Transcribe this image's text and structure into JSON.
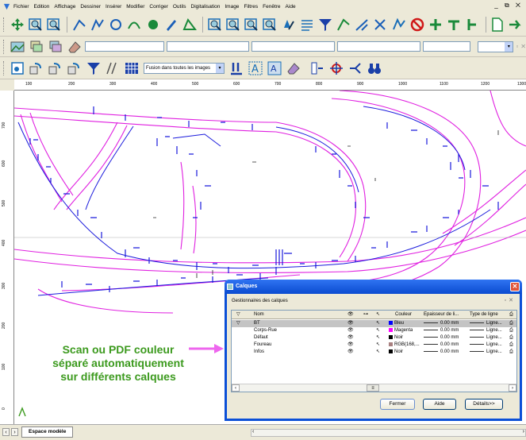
{
  "menubar": {
    "items": [
      "Fichier",
      "Edition",
      "Affichage",
      "Dessiner",
      "Insérer",
      "Modifier",
      "Corriger",
      "Outils",
      "Digitalisation",
      "Image",
      "Filtres",
      "Fenêtre",
      "Aide"
    ],
    "window_controls": "_ ⧉ ✕"
  },
  "toolbar3": {
    "fusion_select": "Fusion dans toutes les images"
  },
  "ruler": {
    "top_ticks": [
      "100",
      "200",
      "300",
      "400",
      "500",
      "600",
      "700",
      "800",
      "900",
      "1000",
      "1100",
      "1200",
      "1300"
    ],
    "left_ticks": [
      "700",
      "600",
      "500",
      "400",
      "300",
      "200",
      "100",
      "0"
    ]
  },
  "bottom": {
    "model_tab": "Espace modèle"
  },
  "dialog": {
    "title": "Calques",
    "subtitle": "Gestionnaires des calques",
    "columns": {
      "nom": "Nom",
      "couleur": "Couleur",
      "epaisseur": "Epaisseur de li...",
      "type": "Type de ligne"
    },
    "layers": [
      {
        "name": "BT",
        "color_name": "Bleu",
        "color": "#0000ff",
        "thickness": "0.00 mm",
        "linetype": "Ligne..."
      },
      {
        "name": "Corps-Rue",
        "color_name": "Magenta",
        "color": "#ff00ff",
        "thickness": "0.00 mm",
        "linetype": "Ligne..."
      },
      {
        "name": "Défaut",
        "color_name": "Noir",
        "color": "#000000",
        "thickness": "0.00 mm",
        "linetype": "Ligne..."
      },
      {
        "name": "Foureau",
        "color_name": "RGB(168,...",
        "color": "#a88080",
        "thickness": "0.00 mm",
        "linetype": "Ligne..."
      },
      {
        "name": "Infos",
        "color_name": "Noir",
        "color": "#000000",
        "thickness": "0.00 mm",
        "linetype": "Ligne..."
      }
    ],
    "buttons": {
      "close": "Fermer",
      "help": "Aide",
      "details": "Détails>>"
    }
  },
  "annotation": {
    "lines": [
      "Scan ou PDF couleur",
      "séparé automatiquement",
      "sur différents calques"
    ]
  },
  "colors": {
    "road_magenta": "#e020e0",
    "network_blue": "#1a1adc",
    "annotation_green": "#3c9a1e",
    "arrow_pink": "#ee66ee"
  }
}
